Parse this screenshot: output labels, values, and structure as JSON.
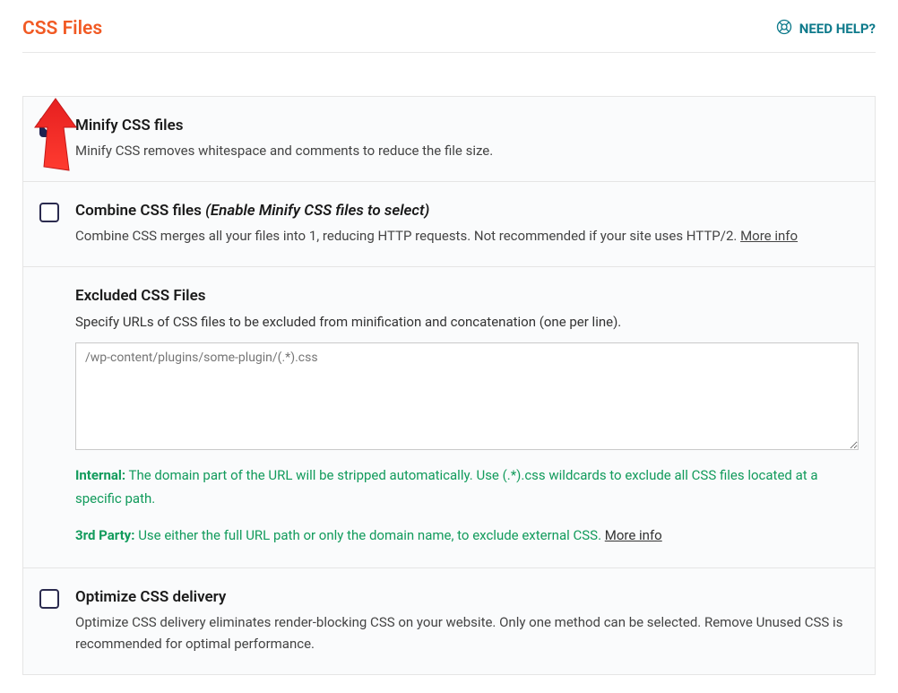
{
  "header": {
    "title": "CSS Files",
    "help_label": "NEED HELP?"
  },
  "options": {
    "minify": {
      "title": "Minify CSS files",
      "desc": "Minify CSS removes whitespace and comments to reduce the file size."
    },
    "combine": {
      "title": "Combine CSS files ",
      "title_italic": "(Enable Minify CSS files to select)",
      "desc": "Combine CSS merges all your files into 1, reducing HTTP requests. Not recommended if your site uses HTTP/2. ",
      "more": "More info"
    },
    "excluded": {
      "title": "Excluded CSS Files",
      "desc": "Specify URLs of CSS files to be excluded from minification and concatenation (one per line).",
      "placeholder": "/wp-content/plugins/some-plugin/(.*).css",
      "note1_label": "Internal:",
      "note1_text": " The domain part of the URL will be stripped automatically. Use (.*).css wildcards to exclude all CSS files located at a specific path.",
      "note2_label": "3rd Party:",
      "note2_text": " Use either the full URL path or only the domain name, to exclude external CSS. ",
      "note2_more": "More info"
    },
    "optimize": {
      "title": "Optimize CSS delivery",
      "desc": "Optimize CSS delivery eliminates render-blocking CSS on your website. Only one method can be selected. Remove Unused CSS is recommended for optimal performance."
    }
  }
}
